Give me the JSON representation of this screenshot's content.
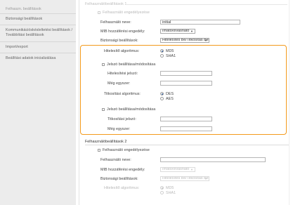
{
  "sidebar": {
    "items": [
      {
        "label": "Felhaszn. beállítások"
      },
      {
        "label": "Biztonsági beállítások"
      },
      {
        "label": "Kommunikációskésleltetési beállítások /"
      },
      {
        "label": "Továbbítási beállítások"
      },
      {
        "label": "Import/export"
      },
      {
        "label": "Beállítási adatok inicializálása"
      }
    ]
  },
  "section1": {
    "title": "Felhasználóbeállítások 1",
    "enable_label": "Felhasználó engedélyezése",
    "username_label": "Felhasználó neve:",
    "username_value": "initial",
    "mib_label": "MIB hozzáférési engedély:",
    "mib_value": "Írható/olvasható",
    "security_label": "Biztonsági beállítások:",
    "security_value": "Hitelesítés Be/Titkosítás Be",
    "auth_algo_label": "Hitelesítő algoritmus:",
    "auth_md5": "MD5",
    "auth_sha1": "SHA1",
    "set_password_label": "Jelszó beállítása/módosítása",
    "auth_password_label": "Hitelesítési jelszó:",
    "confirm_label": "Még egyszer:",
    "enc_algo_label": "Titkosítási algoritmus:",
    "enc_des": "DES",
    "enc_aes": "AES",
    "set_password2_label": "Jelszó beállítása/módosítása",
    "enc_password_label": "Titkosítási jelszó:",
    "confirm2_label": "Még egyszer:"
  },
  "section2": {
    "title": "Felhasználóbeállítások 2",
    "enable_label": "Felhasználó engedélyezése",
    "username_label": "Felhasználó neve:",
    "mib_label": "MIB hozzáférési engedély:",
    "mib_value": "Írható/olvasható",
    "security_label": "Biztonsági beállítások:",
    "security_value": "Hitelesítés Be/Titkosítás Be",
    "auth_algo_label": "Hitelesítő algoritmus:",
    "auth_md5": "MD5",
    "auth_sha1": "SHA1"
  },
  "colors": {
    "highlight": "#f39a1c",
    "sidebar_bg": "#ececec"
  }
}
